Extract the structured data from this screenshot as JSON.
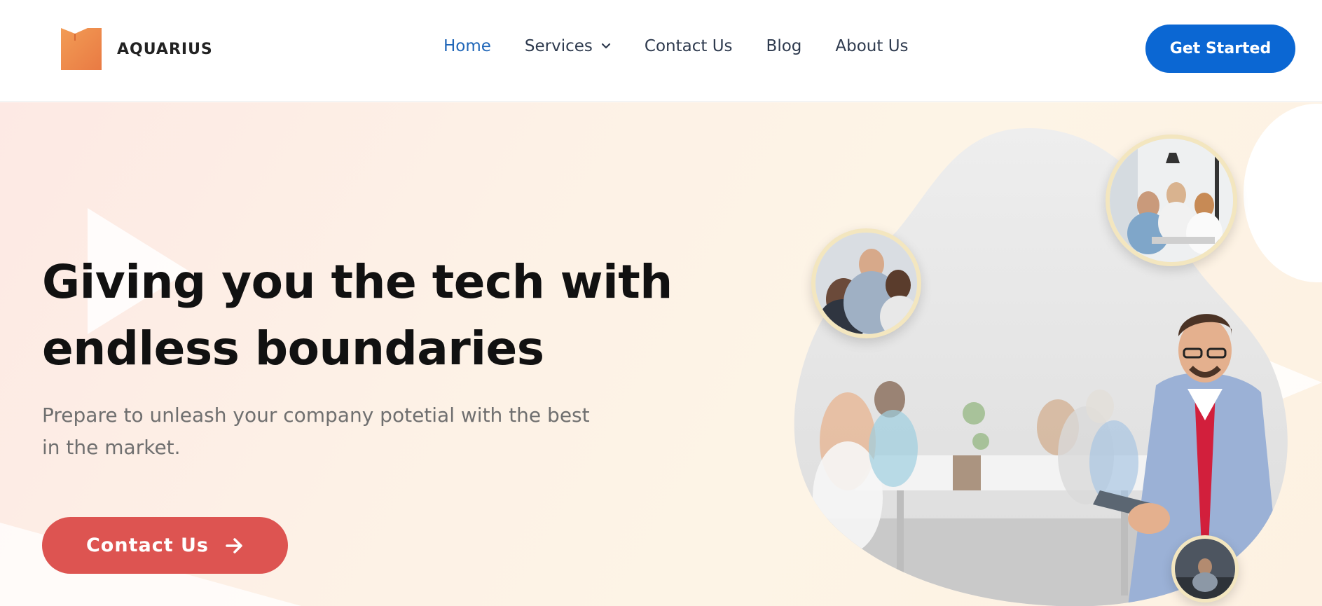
{
  "header": {
    "logo_text": "AQUARIUS",
    "nav": [
      {
        "label": "Home",
        "active": true
      },
      {
        "label": "Services",
        "has_dropdown": true
      },
      {
        "label": "Contact Us"
      },
      {
        "label": "Blog"
      },
      {
        "label": "About Us"
      }
    ],
    "cta_label": "Get Started"
  },
  "hero": {
    "headline_line1": "Giving you the tech with",
    "headline_line2": "endless boundaries",
    "subtext_line1": "Prepare to unleash your company potetial with the best",
    "subtext_line2": "in the market.",
    "cta_label": "Contact Us"
  },
  "colors": {
    "nav_active": "#1f66b8",
    "nav_text": "#2e3a4e",
    "primary_button": "#0b67d3",
    "hero_button": "#dd5451",
    "bubble_border": "#f3e6bf",
    "logo_orange": "#ef8a4a"
  },
  "icons": {
    "services_dropdown": "chevron-down-icon",
    "cta_arrow": "arrow-right-icon",
    "logo": "book-logo-icon"
  }
}
